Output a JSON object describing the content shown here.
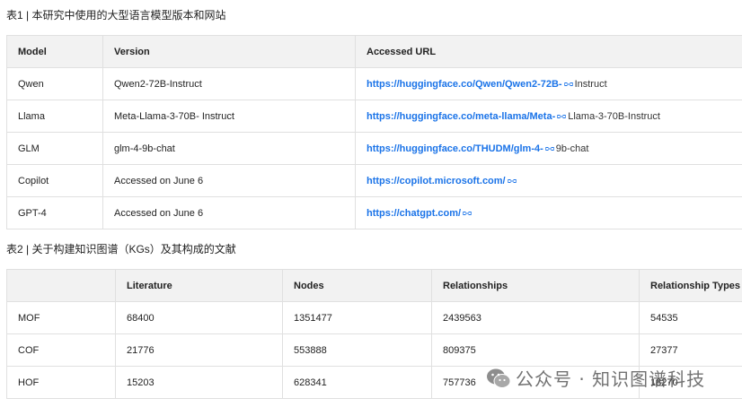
{
  "table1": {
    "caption": "表1 | 本研究中使用的大型语言模型版本和网站",
    "headers": [
      "Model",
      "Version",
      "Accessed URL"
    ],
    "rows": [
      {
        "model": "Qwen",
        "version": "Qwen2-72B-Instruct",
        "url": "https://huggingface.co/Qwen/Qwen2-72B-",
        "suffix": "Instruct"
      },
      {
        "model": "Llama",
        "version": "Meta-Llama-3-70B- Instruct",
        "url": "https://huggingface.co/meta-llama/Meta-",
        "suffix": "Llama-3-70B-Instruct"
      },
      {
        "model": "GLM",
        "version": "glm-4-9b-chat",
        "url": "https://huggingface.co/THUDM/glm-4-",
        "suffix": "9b-chat"
      },
      {
        "model": "Copilot",
        "version": "Accessed on June 6",
        "url": "https://copilot.microsoft.com/",
        "suffix": ""
      },
      {
        "model": "GPT-4",
        "version": "Accessed on June 6",
        "url": "https://chatgpt.com/",
        "suffix": ""
      }
    ]
  },
  "table2": {
    "caption": "表2 | 关于构建知识图谱（KGs）及其构成的文献",
    "headers": [
      "",
      "Literature",
      "Nodes",
      "Relationships",
      "Relationship Types"
    ],
    "rows": [
      [
        "MOF",
        "68400",
        "1351477",
        "2439563",
        "54535"
      ],
      [
        "COF",
        "21776",
        "553888",
        "809375",
        "27377"
      ],
      [
        "HOF",
        "15203",
        "628341",
        "757736",
        "18270"
      ]
    ]
  },
  "watermark": {
    "text": "公众号 · 知识图谱科技",
    "icon": "wechat-icon"
  },
  "colors": {
    "link": "#1a73e8",
    "header_bg": "#f2f2f2",
    "border": "#e0e0e0"
  }
}
